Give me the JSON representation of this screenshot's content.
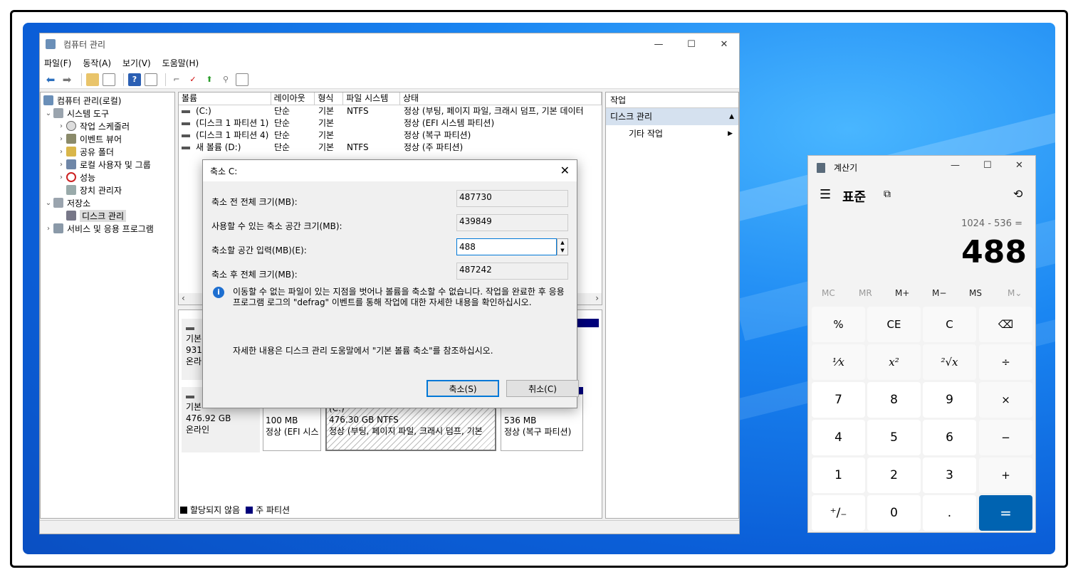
{
  "mmc": {
    "title": "컴퓨터 관리",
    "menu": [
      "파일(F)",
      "동작(A)",
      "보기(V)",
      "도움말(H)"
    ],
    "tree": [
      {
        "label": "컴퓨터 관리(로컬)",
        "level": 0,
        "toggle": "",
        "icon": "computer-management-icon"
      },
      {
        "label": "시스템 도구",
        "level": 1,
        "toggle": "⌄",
        "icon": "tools-icon"
      },
      {
        "label": "작업 스케줄러",
        "level": 2,
        "toggle": "›",
        "icon": "clock-icon"
      },
      {
        "label": "이벤트 뷰어",
        "level": 2,
        "toggle": "›",
        "icon": "event-viewer-icon"
      },
      {
        "label": "공유 폴더",
        "level": 2,
        "toggle": "›",
        "icon": "shared-folder-icon"
      },
      {
        "label": "로컬 사용자 및 그룹",
        "level": 2,
        "toggle": "›",
        "icon": "users-icon"
      },
      {
        "label": "성능",
        "level": 2,
        "toggle": "›",
        "icon": "performance-icon"
      },
      {
        "label": "장치 관리자",
        "level": 2,
        "toggle": "",
        "icon": "device-manager-icon"
      },
      {
        "label": "저장소",
        "level": 1,
        "toggle": "⌄",
        "icon": "storage-icon"
      },
      {
        "label": "디스크 관리",
        "level": 2,
        "toggle": "",
        "icon": "disk-management-icon"
      },
      {
        "label": "서비스 및 응용 프로그램",
        "level": 1,
        "toggle": "›",
        "icon": "services-icon"
      }
    ],
    "columns": [
      "볼륨",
      "레이아웃",
      "형식",
      "파일 시스템",
      "상태"
    ],
    "volumes": [
      [
        "(C:)",
        "단순",
        "기본",
        "NTFS",
        "정상 (부팅, 페이지 파일, 크래시 덤프, 기본 데이터"
      ],
      [
        "(디스크 1 파티션 1)",
        "단순",
        "기본",
        "",
        "정상 (EFI 시스템 파티션)"
      ],
      [
        "(디스크 1 파티션 4)",
        "단순",
        "기본",
        "",
        "정상 (복구 파티션)"
      ],
      [
        "새 볼륨 (D:)",
        "단순",
        "기본",
        "NTFS",
        "정상 (주 파티션)"
      ]
    ],
    "disk0": {
      "type": "기본",
      "size": "931.",
      "status": "온라"
    },
    "disk1": {
      "type": "기본",
      "size": "476.92 GB",
      "status": "온라인"
    },
    "partitions": [
      {
        "name": "",
        "size": "100 MB",
        "status": "정상 (EFI 시스"
      },
      {
        "name": "(C:)",
        "size": "476.30 GB NTFS",
        "status": "정상 (부팅, 페이지 파일, 크래시 덤프, 기본"
      },
      {
        "name": "",
        "size": "536 MB",
        "status": "정상 (복구 파티션)"
      }
    ],
    "legend": {
      "unallocated": "할당되지 않음",
      "primary": "주 파티션"
    },
    "actions": {
      "header": "작업",
      "section": "디스크 관리",
      "more": "기타 작업"
    }
  },
  "dialog": {
    "title": "축소 C:",
    "labels": [
      "축소 전 전체 크기(MB):",
      "사용할 수 있는 축소 공간 크기(MB):",
      "축소할 공간 입력(MB)(E):",
      "축소 후 전체 크기(MB):"
    ],
    "values": [
      "487730",
      "439849",
      "488",
      "487242"
    ],
    "info": "이동할 수 없는 파일이 있는 지점을 벗어나 볼륨을 축소할 수 없습니다. 작업을 완료한 후 응용 프로그램 로그의 \"defrag\" 이벤트를 통해 작업에 대한 자세한 내용을 확인하십시오.",
    "help": "자세한 내용은 디스크 관리 도움말에서 \"기본 볼륨 축소\"를 참조하십시오.",
    "ok": "축소(S)",
    "cancel": "취소(C)"
  },
  "calc": {
    "title": "계산기",
    "mode": "표준",
    "expression": "1024 - 536 =",
    "result": "488",
    "memory": [
      "MC",
      "MR",
      "M+",
      "M−",
      "MS",
      "M⌄"
    ],
    "keys": [
      [
        "%",
        "CE",
        "C",
        "⌫"
      ],
      [
        "¹⁄x",
        "x²",
        "²√x",
        "÷"
      ],
      [
        "7",
        "8",
        "9",
        "×"
      ],
      [
        "4",
        "5",
        "6",
        "−"
      ],
      [
        "1",
        "2",
        "3",
        "+"
      ],
      [
        "⁺∕₋",
        "0",
        ".",
        "="
      ]
    ],
    "accent": "#0063b1"
  }
}
